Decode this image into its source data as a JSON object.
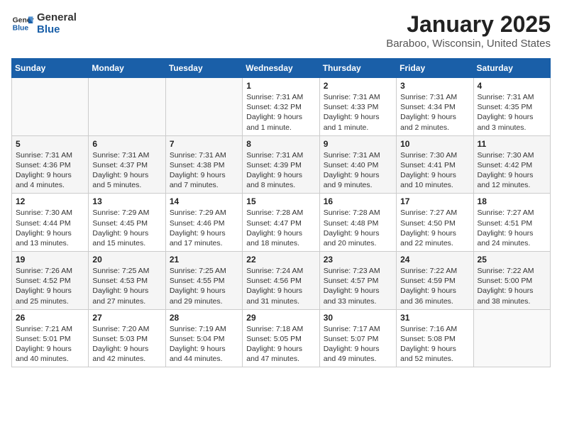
{
  "header": {
    "logo_line1": "General",
    "logo_line2": "Blue",
    "month": "January 2025",
    "location": "Baraboo, Wisconsin, United States"
  },
  "weekdays": [
    "Sunday",
    "Monday",
    "Tuesday",
    "Wednesday",
    "Thursday",
    "Friday",
    "Saturday"
  ],
  "weeks": [
    [
      {
        "day": "",
        "info": ""
      },
      {
        "day": "",
        "info": ""
      },
      {
        "day": "",
        "info": ""
      },
      {
        "day": "1",
        "info": "Sunrise: 7:31 AM\nSunset: 4:32 PM\nDaylight: 9 hours\nand 1 minute."
      },
      {
        "day": "2",
        "info": "Sunrise: 7:31 AM\nSunset: 4:33 PM\nDaylight: 9 hours\nand 1 minute."
      },
      {
        "day": "3",
        "info": "Sunrise: 7:31 AM\nSunset: 4:34 PM\nDaylight: 9 hours\nand 2 minutes."
      },
      {
        "day": "4",
        "info": "Sunrise: 7:31 AM\nSunset: 4:35 PM\nDaylight: 9 hours\nand 3 minutes."
      }
    ],
    [
      {
        "day": "5",
        "info": "Sunrise: 7:31 AM\nSunset: 4:36 PM\nDaylight: 9 hours\nand 4 minutes."
      },
      {
        "day": "6",
        "info": "Sunrise: 7:31 AM\nSunset: 4:37 PM\nDaylight: 9 hours\nand 5 minutes."
      },
      {
        "day": "7",
        "info": "Sunrise: 7:31 AM\nSunset: 4:38 PM\nDaylight: 9 hours\nand 7 minutes."
      },
      {
        "day": "8",
        "info": "Sunrise: 7:31 AM\nSunset: 4:39 PM\nDaylight: 9 hours\nand 8 minutes."
      },
      {
        "day": "9",
        "info": "Sunrise: 7:31 AM\nSunset: 4:40 PM\nDaylight: 9 hours\nand 9 minutes."
      },
      {
        "day": "10",
        "info": "Sunrise: 7:30 AM\nSunset: 4:41 PM\nDaylight: 9 hours\nand 10 minutes."
      },
      {
        "day": "11",
        "info": "Sunrise: 7:30 AM\nSunset: 4:42 PM\nDaylight: 9 hours\nand 12 minutes."
      }
    ],
    [
      {
        "day": "12",
        "info": "Sunrise: 7:30 AM\nSunset: 4:44 PM\nDaylight: 9 hours\nand 13 minutes."
      },
      {
        "day": "13",
        "info": "Sunrise: 7:29 AM\nSunset: 4:45 PM\nDaylight: 9 hours\nand 15 minutes."
      },
      {
        "day": "14",
        "info": "Sunrise: 7:29 AM\nSunset: 4:46 PM\nDaylight: 9 hours\nand 17 minutes."
      },
      {
        "day": "15",
        "info": "Sunrise: 7:28 AM\nSunset: 4:47 PM\nDaylight: 9 hours\nand 18 minutes."
      },
      {
        "day": "16",
        "info": "Sunrise: 7:28 AM\nSunset: 4:48 PM\nDaylight: 9 hours\nand 20 minutes."
      },
      {
        "day": "17",
        "info": "Sunrise: 7:27 AM\nSunset: 4:50 PM\nDaylight: 9 hours\nand 22 minutes."
      },
      {
        "day": "18",
        "info": "Sunrise: 7:27 AM\nSunset: 4:51 PM\nDaylight: 9 hours\nand 24 minutes."
      }
    ],
    [
      {
        "day": "19",
        "info": "Sunrise: 7:26 AM\nSunset: 4:52 PM\nDaylight: 9 hours\nand 25 minutes."
      },
      {
        "day": "20",
        "info": "Sunrise: 7:25 AM\nSunset: 4:53 PM\nDaylight: 9 hours\nand 27 minutes."
      },
      {
        "day": "21",
        "info": "Sunrise: 7:25 AM\nSunset: 4:55 PM\nDaylight: 9 hours\nand 29 minutes."
      },
      {
        "day": "22",
        "info": "Sunrise: 7:24 AM\nSunset: 4:56 PM\nDaylight: 9 hours\nand 31 minutes."
      },
      {
        "day": "23",
        "info": "Sunrise: 7:23 AM\nSunset: 4:57 PM\nDaylight: 9 hours\nand 33 minutes."
      },
      {
        "day": "24",
        "info": "Sunrise: 7:22 AM\nSunset: 4:59 PM\nDaylight: 9 hours\nand 36 minutes."
      },
      {
        "day": "25",
        "info": "Sunrise: 7:22 AM\nSunset: 5:00 PM\nDaylight: 9 hours\nand 38 minutes."
      }
    ],
    [
      {
        "day": "26",
        "info": "Sunrise: 7:21 AM\nSunset: 5:01 PM\nDaylight: 9 hours\nand 40 minutes."
      },
      {
        "day": "27",
        "info": "Sunrise: 7:20 AM\nSunset: 5:03 PM\nDaylight: 9 hours\nand 42 minutes."
      },
      {
        "day": "28",
        "info": "Sunrise: 7:19 AM\nSunset: 5:04 PM\nDaylight: 9 hours\nand 44 minutes."
      },
      {
        "day": "29",
        "info": "Sunrise: 7:18 AM\nSunset: 5:05 PM\nDaylight: 9 hours\nand 47 minutes."
      },
      {
        "day": "30",
        "info": "Sunrise: 7:17 AM\nSunset: 5:07 PM\nDaylight: 9 hours\nand 49 minutes."
      },
      {
        "day": "31",
        "info": "Sunrise: 7:16 AM\nSunset: 5:08 PM\nDaylight: 9 hours\nand 52 minutes."
      },
      {
        "day": "",
        "info": ""
      }
    ]
  ]
}
